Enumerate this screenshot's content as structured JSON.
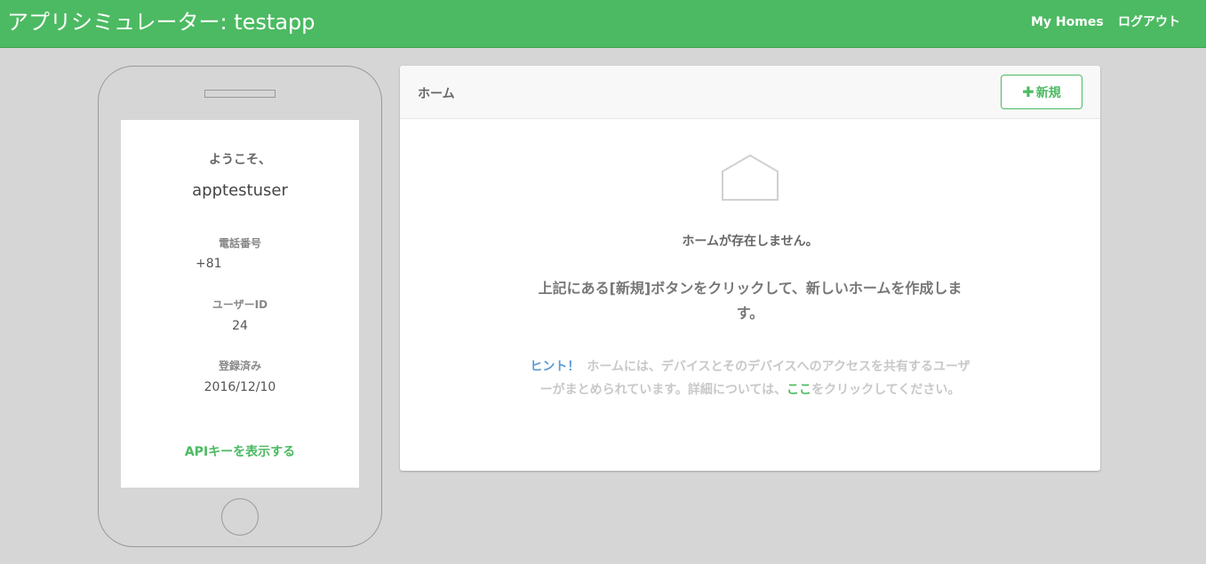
{
  "nav": {
    "title": "アプリシミュレーター: testapp",
    "my_homes": "My Homes",
    "logout": "ログアウト"
  },
  "phone": {
    "welcome": "ようこそ、",
    "username": "apptestuser",
    "phone_label": "電話番号",
    "phone_value": "+81",
    "userid_label": "ユーザーID",
    "userid_value": "24",
    "registered_label": "登録済み",
    "registered_value": "2016/12/10",
    "api_link": "APIキーを表示する"
  },
  "panel": {
    "title": "ホーム",
    "new_button": "新規",
    "empty_message": "ホームが存在しません。",
    "instruction": "上記にある[新規]ボタンをクリックして、新しいホームを作成します。",
    "hint_label": "ヒント！",
    "hint_text": "ホームには、デバイスとそのデバイスへのアクセスを共有するユーザーがまとめられています。詳細については、",
    "hint_link": "ここ",
    "hint_suffix": "をクリックしてください。"
  },
  "icons": {
    "plus": "plus-icon",
    "home": "house-outline-icon"
  },
  "colors": {
    "brand_green": "#4cba62",
    "hint_blue": "#5b9bd5",
    "background": "#d6d6d6"
  }
}
